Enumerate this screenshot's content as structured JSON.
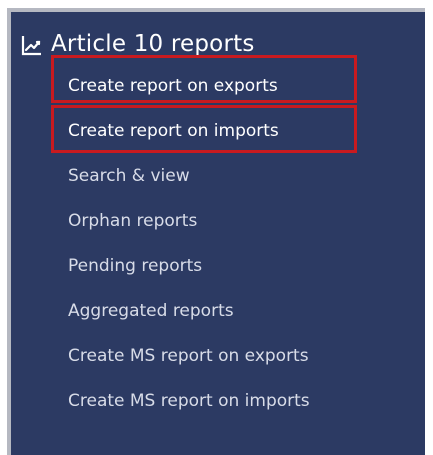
{
  "section": {
    "title": "Article 10 reports",
    "icon": "chart-line-icon"
  },
  "menu": {
    "items": [
      {
        "label": "Create report on exports",
        "active": true
      },
      {
        "label": "Create report on imports",
        "active": true
      },
      {
        "label": "Search & view",
        "active": false
      },
      {
        "label": "Orphan reports",
        "active": false
      },
      {
        "label": "Pending reports",
        "active": false
      },
      {
        "label": "Aggregated reports",
        "active": false
      },
      {
        "label": "Create MS report on exports",
        "active": false
      },
      {
        "label": "Create MS report on imports",
        "active": false
      }
    ]
  },
  "colors": {
    "panel_background": "#2c3a63",
    "highlight": "#c91a1f",
    "text": "#d8dce8",
    "title": "#ffffff"
  }
}
